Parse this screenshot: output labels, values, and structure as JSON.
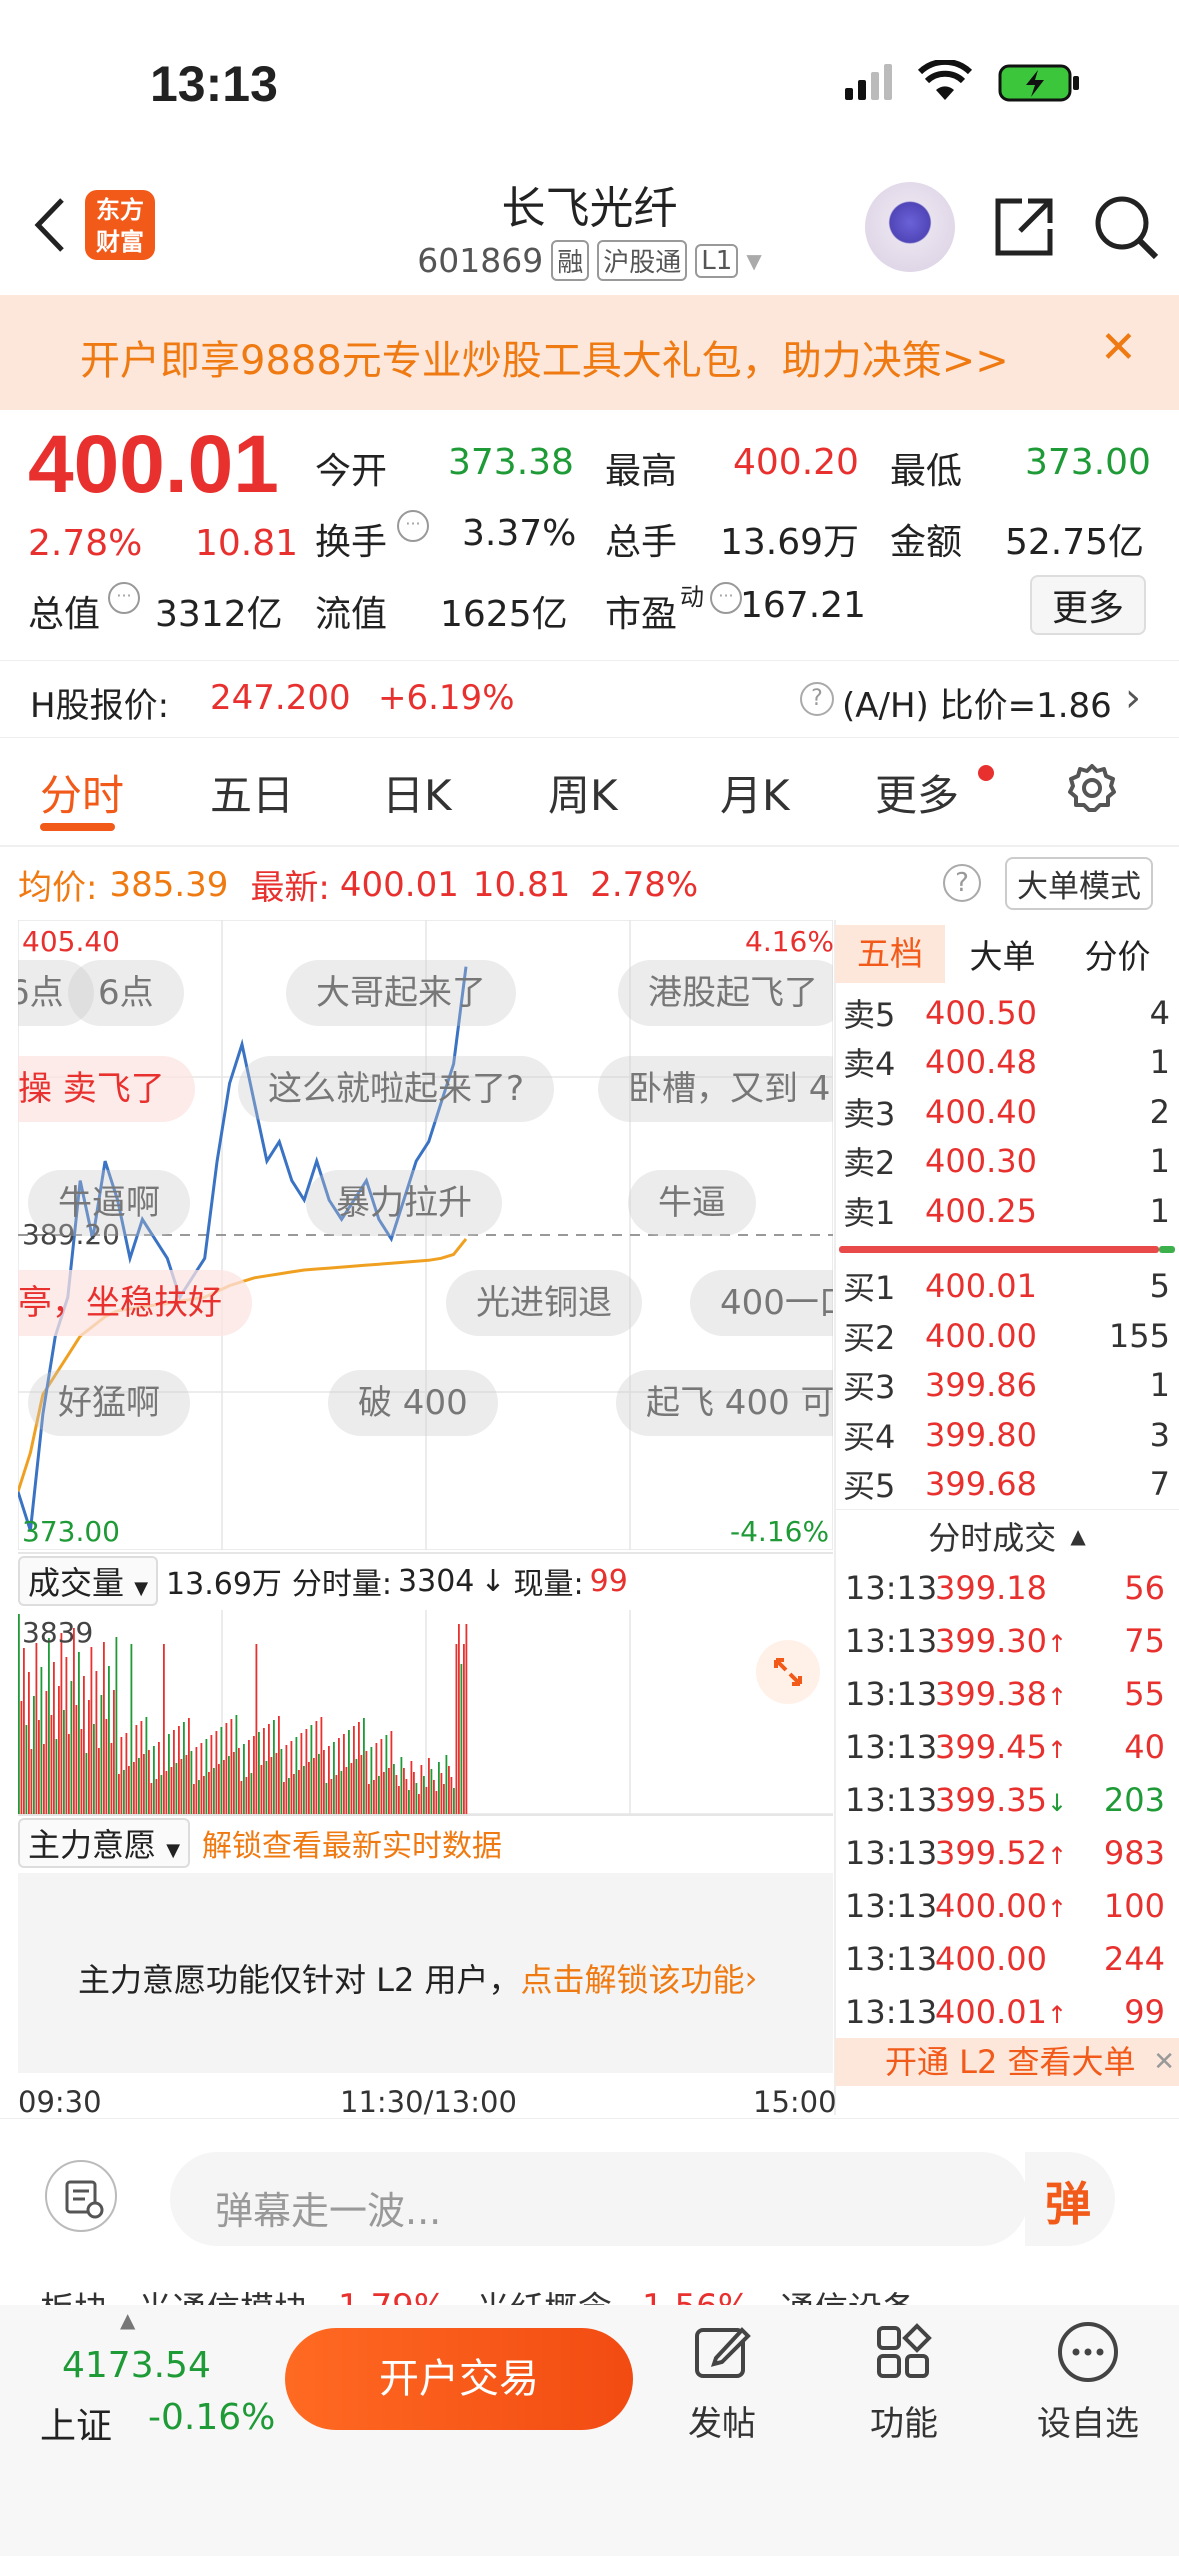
{
  "status": {
    "time": "13:13"
  },
  "header": {
    "logo_line1": "东方",
    "logo_line2": "财富",
    "title": "长飞光纤",
    "code": "601869",
    "tags": [
      "融",
      "沪股通",
      "L1"
    ]
  },
  "banner": {
    "text": "开户即享9888元专业炒股工具大礼包，助力决策>>",
    "close": "✕"
  },
  "quote": {
    "price": "400.01",
    "pct": "2.78%",
    "change": "10.81",
    "open_label": "今开",
    "open": "373.38",
    "high_label": "最高",
    "high": "400.20",
    "low_label": "最低",
    "low": "373.00",
    "turnover_label": "换手",
    "turnover": "3.37%",
    "vol_label": "总手",
    "vol": "13.69万",
    "amount_label": "金额",
    "amount": "52.75亿",
    "mcap_label": "总值",
    "mcap": "3312亿",
    "float_label": "流值",
    "float": "1625亿",
    "pe_label": "市盈",
    "pe_sup": "动",
    "pe": "167.21",
    "more": "更多"
  },
  "hk": {
    "label": "H股报价:",
    "price": "247.200",
    "pct": "+6.19%",
    "ah": "(A/H) 比价=1.86"
  },
  "tabs": [
    "分时",
    "五日",
    "日K",
    "周K",
    "月K",
    "更多"
  ],
  "chart_info": {
    "avg_label": "均价:",
    "avg": "385.39",
    "latest_label": "最新:",
    "latest": "400.01",
    "chg": "10.81",
    "pct": "2.78%",
    "mode": "大单模式",
    "help": "?"
  },
  "chart_axis": {
    "top_left": "405.40",
    "top_right": "4.16%",
    "mid_left": "389.20",
    "bottom_left": "373.00",
    "bottom_right": "-4.16%"
  },
  "bubbles": [
    "6点",
    "大哥起来了",
    "港股起飞了",
    "操 卖飞了",
    "这么就啦起来了?",
    "卧槽，又到 4",
    "牛逼啊",
    "暴力拉升",
    "牛逼",
    "亭，坐稳扶好",
    "光进铜退",
    "400一口",
    "好猛啊",
    "破 400",
    "起飞 400 可"
  ],
  "panel_tabs": [
    "五档",
    "大单",
    "分价"
  ],
  "orderbook": {
    "asks": [
      {
        "label": "卖5",
        "price": "400.50",
        "vol": "4"
      },
      {
        "label": "卖4",
        "price": "400.48",
        "vol": "1"
      },
      {
        "label": "卖3",
        "price": "400.40",
        "vol": "2"
      },
      {
        "label": "卖2",
        "price": "400.30",
        "vol": "1"
      },
      {
        "label": "卖1",
        "price": "400.25",
        "vol": "1"
      }
    ],
    "bids": [
      {
        "label": "买1",
        "price": "400.01",
        "vol": "5"
      },
      {
        "label": "买2",
        "price": "400.00",
        "vol": "155"
      },
      {
        "label": "买3",
        "price": "399.86",
        "vol": "1"
      },
      {
        "label": "买4",
        "price": "399.80",
        "vol": "3"
      },
      {
        "label": "买5",
        "price": "399.68",
        "vol": "7"
      }
    ]
  },
  "ticks_title": "分时成交",
  "ticks": [
    {
      "t": "13:13",
      "p": "399.18",
      "a": "",
      "v": "56",
      "c": "#e8312e"
    },
    {
      "t": "13:13",
      "p": "399.30",
      "a": "↑",
      "v": "75",
      "c": "#e8312e"
    },
    {
      "t": "13:13",
      "p": "399.38",
      "a": "↑",
      "v": "55",
      "c": "#e8312e"
    },
    {
      "t": "13:13",
      "p": "399.45",
      "a": "↑",
      "v": "40",
      "c": "#e8312e"
    },
    {
      "t": "13:13",
      "p": "399.35",
      "a": "↓",
      "v": "203",
      "c": "#1e9a36"
    },
    {
      "t": "13:13",
      "p": "399.52",
      "a": "↑",
      "v": "983",
      "c": "#e8312e"
    },
    {
      "t": "13:13",
      "p": "400.00",
      "a": "↑",
      "v": "100",
      "c": "#e8312e"
    },
    {
      "t": "13:13",
      "p": "400.00",
      "a": "",
      "v": "244",
      "c": "#e8312e"
    },
    {
      "t": "13:13",
      "p": "400.01",
      "a": "↑",
      "v": "99",
      "c": "#e8312e"
    }
  ],
  "l2_banner": "开通 L2 查看大单",
  "volume": {
    "select": "成交量",
    "total": "13.69万",
    "fen_label": "分时量:",
    "fen": "3304",
    "arrow": "↓",
    "now_label": "现量:",
    "now": "99",
    "max": "3839"
  },
  "zhuli": {
    "select": "主力意愿",
    "unlock": "解锁查看最新实时数据",
    "msg": "主力意愿功能仅针对 L2 用户，",
    "msg_link": "点击解锁该功能"
  },
  "time_axis": [
    "09:30",
    "11:30/13:00",
    "15:00"
  ],
  "comment": {
    "placeholder": "弹幕走一波...",
    "danmu": "弹"
  },
  "ticker": [
    "板块",
    "光通信模块",
    "1.79%",
    "光纤概念",
    "1.56%",
    "通信设备"
  ],
  "bottom": {
    "index_value": "4173.54",
    "index_name": "上证",
    "index_pct": "-0.16%",
    "trade": "开户交易",
    "nav": [
      "发帖",
      "功能",
      "设自选"
    ]
  },
  "chart_data": {
    "type": "line",
    "title": "",
    "y_range": [
      373.0,
      405.4
    ],
    "series": [
      {
        "name": "price",
        "values": [
          376,
          374,
          380,
          384,
          386,
          392,
          389,
          393,
          391,
          388,
          390,
          389,
          388,
          386,
          387,
          388,
          393,
          397,
          399,
          396,
          393,
          394,
          392,
          391,
          393,
          391,
          390,
          391,
          392,
          390,
          389,
          391,
          393,
          394,
          396,
          398,
          403
        ]
      },
      {
        "name": "avg",
        "values": [
          376,
          378,
          381,
          382,
          383,
          384,
          384.5,
          385,
          385.3,
          385.4,
          385.5,
          385.6,
          385.7,
          385.8,
          385.9,
          386,
          386.3,
          386.6,
          386.8,
          387,
          387.1,
          387.2,
          387.3,
          387.4,
          387.45,
          387.5,
          387.55,
          387.6,
          387.65,
          387.7,
          387.75,
          387.8,
          387.85,
          387.9,
          388,
          388.2,
          389
        ]
      }
    ]
  }
}
